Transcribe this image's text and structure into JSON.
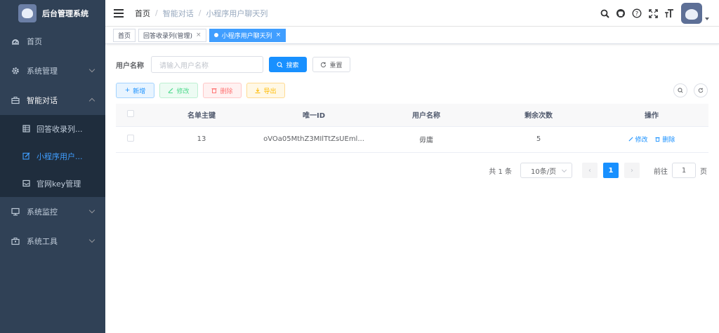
{
  "app": {
    "title": "后台管理系统"
  },
  "sidebar": {
    "items": [
      {
        "label": "首页",
        "icon": "dashboard-icon"
      },
      {
        "label": "系统管理",
        "icon": "gear-icon"
      },
      {
        "label": "智能对话",
        "icon": "briefcase-icon"
      },
      {
        "label": "系统监控",
        "icon": "monitor-icon"
      },
      {
        "label": "系统工具",
        "icon": "toolbox-icon"
      }
    ],
    "subitems": [
      {
        "label": "回答收录列...",
        "icon": "table-icon"
      },
      {
        "label": "小程序用户...",
        "icon": "edit-icon"
      },
      {
        "label": "官网key管理",
        "icon": "message-icon"
      }
    ]
  },
  "header": {
    "breadcrumb": [
      "首页",
      "智能对话",
      "小程序用户聊天列"
    ]
  },
  "tags": [
    {
      "label": "首页"
    },
    {
      "label": "回答收录列(管理)",
      "close": "×"
    },
    {
      "label": "小程序用户聊天列",
      "close": "×"
    }
  ],
  "search": {
    "label": "用户名称",
    "placeholder": "请输入用户名称",
    "search_btn": "搜索",
    "reset_btn": "重置"
  },
  "toolbar": {
    "add": "新增",
    "edit": "修改",
    "delete": "删除",
    "export": "导出"
  },
  "table": {
    "headers": [
      "名单主键",
      "唯一ID",
      "用户名称",
      "剩余次数",
      "操作"
    ],
    "rows": [
      {
        "id": "13",
        "uid": "oVOa05MthZ3MIlTtZsUEml...",
        "name": "毋庸",
        "remaining": "5",
        "edit": "修改",
        "delete": "删除"
      }
    ]
  },
  "pagination": {
    "total": "共 1 条",
    "page_size": "10条/页",
    "prev": "‹",
    "current": "1",
    "next": "›",
    "goto_label": "前往",
    "goto_value": "1",
    "goto_suffix": "页"
  },
  "colors": {
    "sidebar": "#304156",
    "primary": "#1890ff"
  }
}
